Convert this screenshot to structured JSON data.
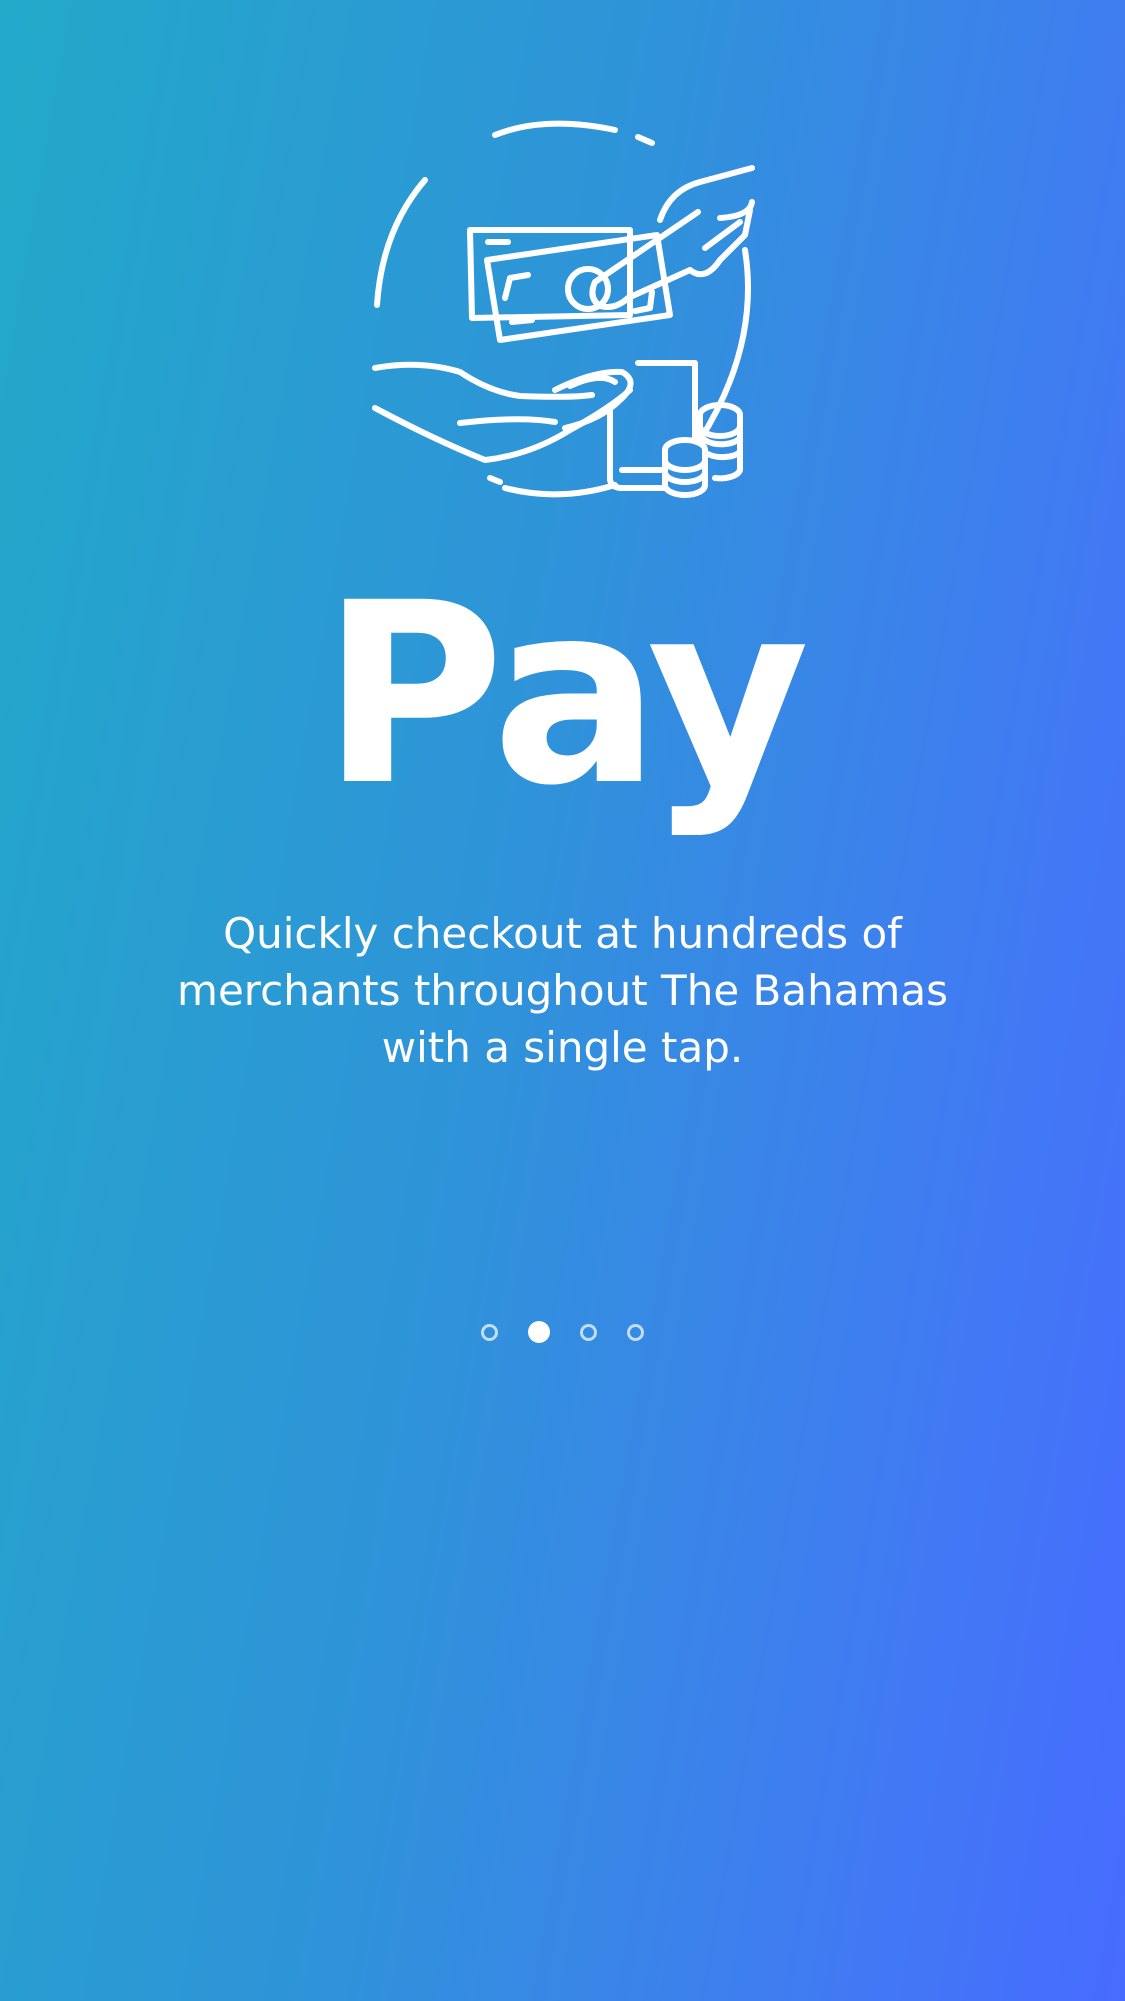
{
  "onboarding": {
    "illustration_icon": "hand-giving-cash-coins-icon",
    "title": "Pay",
    "description": "Quickly checkout at hundreds of merchants throughout The Bahamas with a single tap.",
    "pager": {
      "total_pages": 4,
      "active_page": 2
    }
  },
  "colors": {
    "gradient_start": "#22a9c9",
    "gradient_end": "#476bff",
    "foreground": "#ffffff"
  }
}
